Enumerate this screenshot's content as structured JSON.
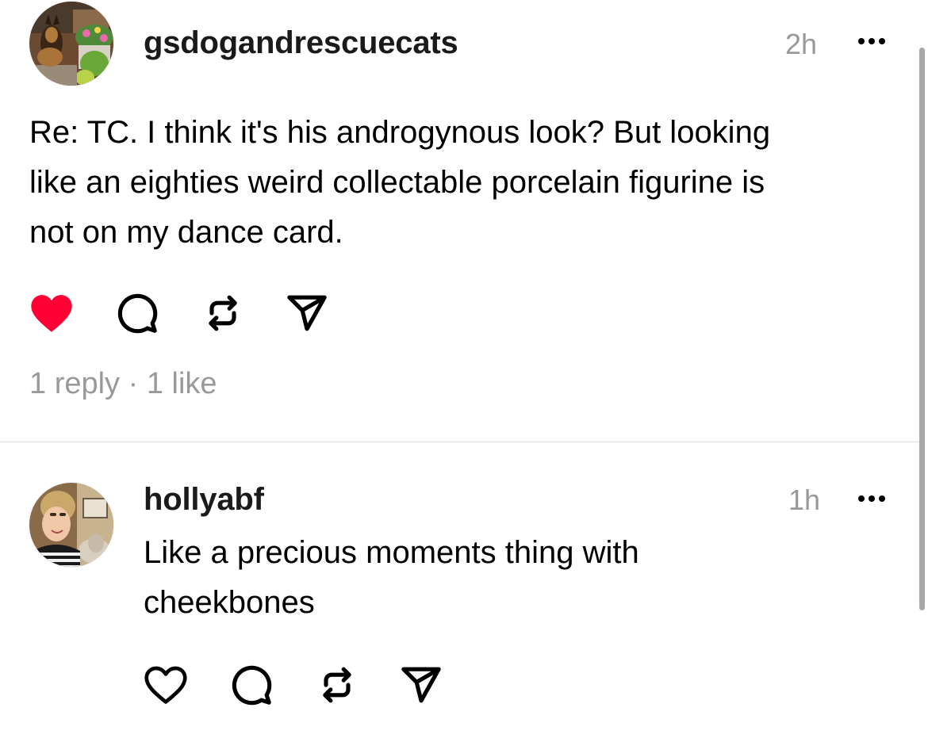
{
  "posts": [
    {
      "username": "gsdogandrescuecats",
      "time": "2h",
      "body_lines": [
        "Re: TC. I think it's his androgynous look? But looking",
        "like an eighties weird collectable porcelain figurine is",
        "not on my dance card."
      ],
      "liked": true,
      "replies_label": "1 reply",
      "separator": "·",
      "likes_label": "1 like"
    },
    {
      "username": "hollyabf",
      "time": "1h",
      "body_lines": [
        "Like a precious moments thing with",
        "cheekbones"
      ],
      "liked": false
    }
  ],
  "icons": {
    "like": "heart-icon",
    "reply": "comment-icon",
    "repost": "repost-icon",
    "share": "send-icon",
    "more": "more-dots-icon"
  },
  "colors": {
    "like_active": "#FF0034",
    "muted_text": "#999999",
    "divider": "#E0E0E0"
  }
}
